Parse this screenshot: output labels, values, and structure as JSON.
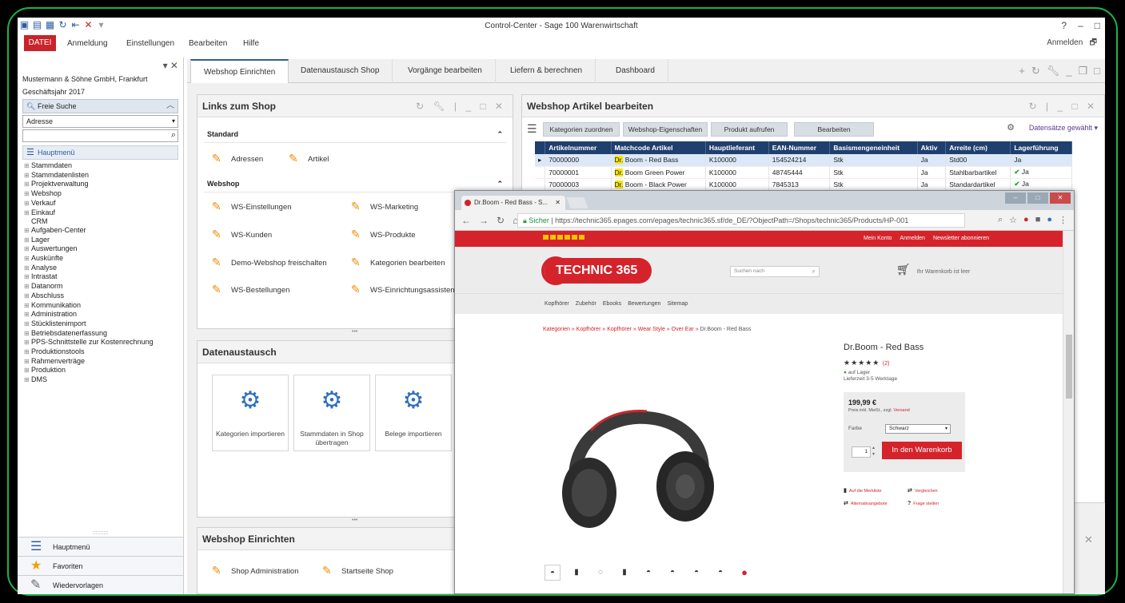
{
  "app": {
    "title": "Control-Center - Sage 100 Warenwirtschaft",
    "window_controls": [
      "?",
      "–",
      "□"
    ],
    "quick_access_icons": [
      "save-icon",
      "table-icon",
      "calculator-icon",
      "refresh-icon",
      "back-icon",
      "delete-icon",
      "dropdown-icon"
    ]
  },
  "menu": {
    "datei": "DATEI",
    "items": [
      "Anmeldung",
      "Einstellungen",
      "Bearbeiten",
      "Hilfe"
    ],
    "anmelden": "Anmelden",
    "accent": "#c9232b"
  },
  "sidebar": {
    "company": "Mustermann & Söhne GmbH, Frankfurt",
    "fiscal_year": "Geschäftsjahr 2017",
    "search_label": "Freie Suche",
    "select_value": "Adresse",
    "menu_header": "Hauptmenü",
    "tree": [
      "Stammdaten",
      "Stammdatenlisten",
      "Projektverwaltung",
      "Webshop",
      "Verkauf",
      "Einkauf",
      "CRM",
      "Aufgaben-Center",
      "Lager",
      "Auswertungen",
      "Auskünfte",
      "Analyse",
      "Intrastat",
      "Datanorm",
      "Abschluss",
      "Kommunikation",
      "Administration",
      "Stücklistenimport",
      "Betriebsdatenerfassung",
      "PPS-Schnittstelle zur Kostenrechnung",
      "Produktionstools",
      "Rahmenverträge",
      "Produktion",
      "DMS"
    ],
    "bottom": [
      "Hauptmenü",
      "Favoriten",
      "Wiedervorlagen"
    ]
  },
  "tabs": [
    "Webshop Einrichten",
    "Datenaustausch Shop",
    "Vorgänge bearbeiten",
    "Liefern & berechnen",
    "Dashboard"
  ],
  "links_panel": {
    "title": "Links zum Shop",
    "standard": "Standard",
    "standard_links": [
      "Adressen",
      "Artikel"
    ],
    "webshop": "Webshop",
    "webshop_links": [
      "WS-Einstellungen",
      "WS-Marketing",
      "WS-Kunden",
      "WS-Produkte",
      "Demo-Webshop freischalten",
      "Kategorien bearbeiten",
      "WS-Bestellungen",
      "WS-Einrichtungsassisten"
    ]
  },
  "datenaustausch": {
    "title": "Datenaustausch",
    "tiles": [
      "Kategorien importieren",
      "Stammdaten in Shop übertragen",
      "Belege importieren"
    ]
  },
  "webshop_einrichten": {
    "title": "Webshop Einrichten",
    "links": [
      "Shop Administration",
      "Startseite Shop"
    ]
  },
  "artikel_panel": {
    "title": "Webshop Artikel bearbeiten",
    "buttons": [
      "Kategorien zuordnen",
      "Webshop-Eigenschaften",
      "Produkt aufrufen",
      "Bearbeiten"
    ],
    "datensaetze": "Datensätze gewählt",
    "columns": [
      "Artikelnummer",
      "Matchcode Artikel",
      "Hauptlieferant",
      "EAN-Nummer",
      "Basismengeneinheit",
      "Aktiv",
      "Arreite (cm)",
      "Lagerführung"
    ],
    "rows": [
      {
        "nr": "70000000",
        "hl": "Dr.",
        "match": " Boom - Red Bass",
        "lief": "K100000",
        "ean": "154524214",
        "einh": "Stk",
        "aktiv": "Ja",
        "breite": "Std00",
        "check": "",
        "lager": "Ja"
      },
      {
        "nr": "70000001",
        "hl": "Dr.",
        "match": " Boom Green Power",
        "lief": "K100000",
        "ean": "48745444",
        "einh": "Stk",
        "aktiv": "Ja",
        "breite": "Stahlbarbartikel",
        "check": "✔",
        "lager": "Ja"
      },
      {
        "nr": "70000003",
        "hl": "Dr.",
        "match": " Boom - Black Power",
        "lief": "K100000",
        "ean": "7845313",
        "einh": "Stk",
        "aktiv": "Ja",
        "breite": "Standardartikel",
        "check": "✔",
        "lager": "Ja"
      }
    ]
  },
  "browser": {
    "tab_title": "Dr.Boom - Red Bass - S...",
    "secure": "Sicher",
    "url": "https://technic365.epages.com/epages/technic365.sf/de_DE/?ObjectPath=/Shops/technic365/Products/HP-001"
  },
  "shop": {
    "top_links": [
      "Mein Konto",
      "Anmelden",
      "Newsletter abonnieren"
    ],
    "logo": "TECHNIC 365",
    "search_placeholder": "Suchen nach",
    "cart_text": "Ihr Warenkorb ist leer",
    "nav": [
      "Kopfhörer",
      "Zubehör",
      "Ebooks",
      "Bewertungen",
      "Sitemap"
    ],
    "breadcrumb": [
      "Kategorien",
      "Kopfhörer",
      "Kopfhörer",
      "Wear Style",
      "Over Ear"
    ],
    "breadcrumb_current": "Dr.Boom - Red Bass",
    "product_title": "Dr.Boom - Red Bass",
    "stars": "★★★★★",
    "reviews": "(2)",
    "stock": "auf Lager",
    "delivery": "Lieferzeit 3-5 Werktage",
    "price": "199,99 €",
    "price_info": "Preis inkl. MwSt., zzgl.",
    "shipping_link": "Versand",
    "farbe_label": "Farbe",
    "farbe_value": "Schwarz",
    "qty": "1",
    "cart_button": "In den Warenkorb",
    "actions": [
      "Auf die Merkliste",
      "Vergleichen",
      "Alternativangebote",
      "Frage stellen"
    ],
    "brand_color": "#d5232b"
  }
}
